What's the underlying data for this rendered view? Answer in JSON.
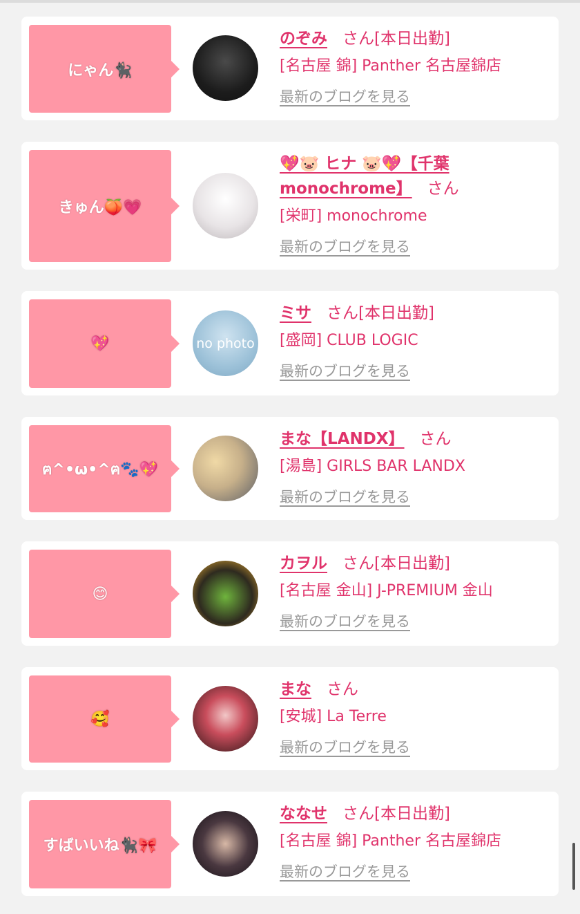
{
  "cards": [
    {
      "bubble": "にゃん🐈‍⬛",
      "name": "のぞみ",
      "name_line2": "",
      "san": "さん",
      "status": "[本日出勤]",
      "shop": "[名古屋 錦] Panther 名古屋錦店",
      "blog": "最新のブログを見る",
      "avatar_text": ""
    },
    {
      "bubble": "きゅん🍑💗",
      "name": "💖🐷 ヒナ 🐷💖【千葉",
      "name_line2": "monochrome】",
      "san": "さん",
      "status": "",
      "shop": "[栄町] monochrome",
      "blog": "最新のブログを見る",
      "avatar_text": ""
    },
    {
      "bubble": "💖",
      "name": "ミサ",
      "name_line2": "",
      "san": "さん",
      "status": "[本日出勤]",
      "shop": "[盛岡] CLUB LOGIC",
      "blog": "最新のブログを見る",
      "avatar_text": "no photo"
    },
    {
      "bubble": "ฅ^•ω•^ฅ🐾💖",
      "name": "まな【LANDX】",
      "name_line2": "",
      "san": "さん",
      "status": "",
      "shop": "[湯島] GIRLS BAR LANDX",
      "blog": "最新のブログを見る",
      "avatar_text": ""
    },
    {
      "bubble": "😊",
      "name": "カヲル",
      "name_line2": "",
      "san": "さん",
      "status": "[本日出勤]",
      "shop": "[名古屋 金山] J-PREMIUM 金山",
      "blog": "最新のブログを見る",
      "avatar_text": ""
    },
    {
      "bubble": "🥰",
      "name": "まな",
      "name_line2": "",
      "san": "さん",
      "status": "",
      "shop": "[安城] La Terre",
      "blog": "最新のブログを見る",
      "avatar_text": ""
    },
    {
      "bubble": "すばいいね🐈‍⬛🎀",
      "name": "ななせ",
      "name_line2": "",
      "san": "さん",
      "status": "[本日出勤]",
      "shop": "[名古屋 錦] Panther 名古屋錦店",
      "blog": "最新のブログを見る",
      "avatar_text": ""
    }
  ],
  "colors": {
    "accent": "#e0336b",
    "bubble": "#ff97a6",
    "link_gray": "#999999",
    "background": "#f2f2f2"
  }
}
